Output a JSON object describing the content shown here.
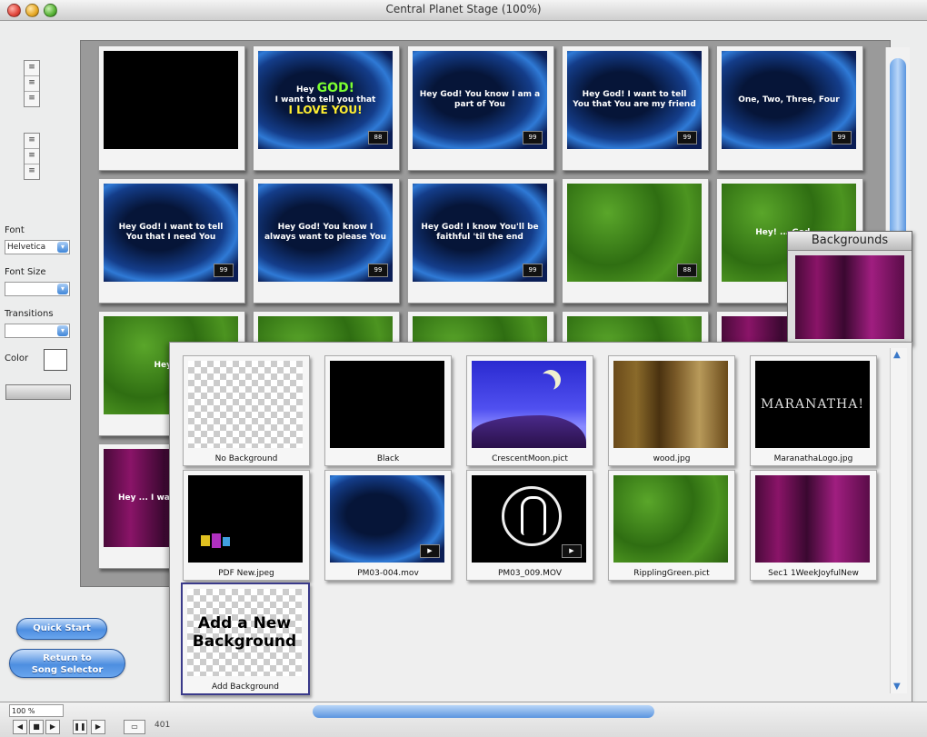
{
  "window": {
    "title": "Central Planet Stage (100%)"
  },
  "left_panel": {
    "font_label": "Font",
    "font_value": "Helvetica",
    "font_size_label": "Font Size",
    "font_size_value": "",
    "transitions_label": "Transitions",
    "transitions_value": "",
    "color_label": "Color",
    "apply_label": "",
    "quick_start_label": "Quick Start",
    "return_label_1": "Return to",
    "return_label_2": "Song Selector"
  },
  "slides": [
    {
      "bg": "black",
      "text": ""
    },
    {
      "bg": "blue",
      "line1": "Hey",
      "big": "GOD!",
      "line2": "I want to tell you that",
      "yel": "I LOVE YOU!",
      "badge": "88"
    },
    {
      "bg": "blue",
      "text": "Hey God! You know I am a part of You",
      "badge": "99"
    },
    {
      "bg": "blue",
      "text": "Hey God! I want to tell You that You are my friend",
      "badge": "99"
    },
    {
      "bg": "blue",
      "text": "One, Two, Three, Four",
      "badge": "99"
    },
    {
      "bg": "blue",
      "text": "Hey God! I want to tell You that I need You",
      "badge": "99"
    },
    {
      "bg": "blue",
      "text": "Hey God! You know I always want to please You",
      "badge": "99"
    },
    {
      "bg": "blue",
      "text": "Hey God! I know You'll be faithful 'til the end",
      "badge": "99"
    },
    {
      "bg": "green",
      "text": "",
      "badge": "88"
    },
    {
      "bg": "green",
      "text": "Hey! ... God ..."
    },
    {
      "bg": "green",
      "text": "Hey! ..."
    },
    {
      "bg": "magenta",
      "text": "Hey ... I want to ... You"
    }
  ],
  "backgrounds_panel": {
    "title": "Backgrounds"
  },
  "backgrounds": [
    {
      "type": "checker",
      "caption": "No Background"
    },
    {
      "type": "black",
      "caption": "Black"
    },
    {
      "type": "crescent",
      "caption": "CrescentMoon.pict"
    },
    {
      "type": "wood",
      "caption": "wood.jpg"
    },
    {
      "type": "logo",
      "caption": "MaranathaLogo.jpg",
      "logo_text": "MARANATHA!"
    },
    {
      "type": "kids",
      "caption": "PDF New.jpeg"
    },
    {
      "type": "blue",
      "caption": "PM03-004.mov"
    },
    {
      "type": "circle",
      "caption": "PM03_009.MOV"
    },
    {
      "type": "green",
      "caption": "RipplingGreen.pict"
    },
    {
      "type": "magenta",
      "caption": "Sec1 1WeekJoyfulNew"
    }
  ],
  "add_background": {
    "text": "Add a New Background",
    "caption": "Add Background"
  },
  "bottom": {
    "zoom": "100 %",
    "count": "401"
  }
}
